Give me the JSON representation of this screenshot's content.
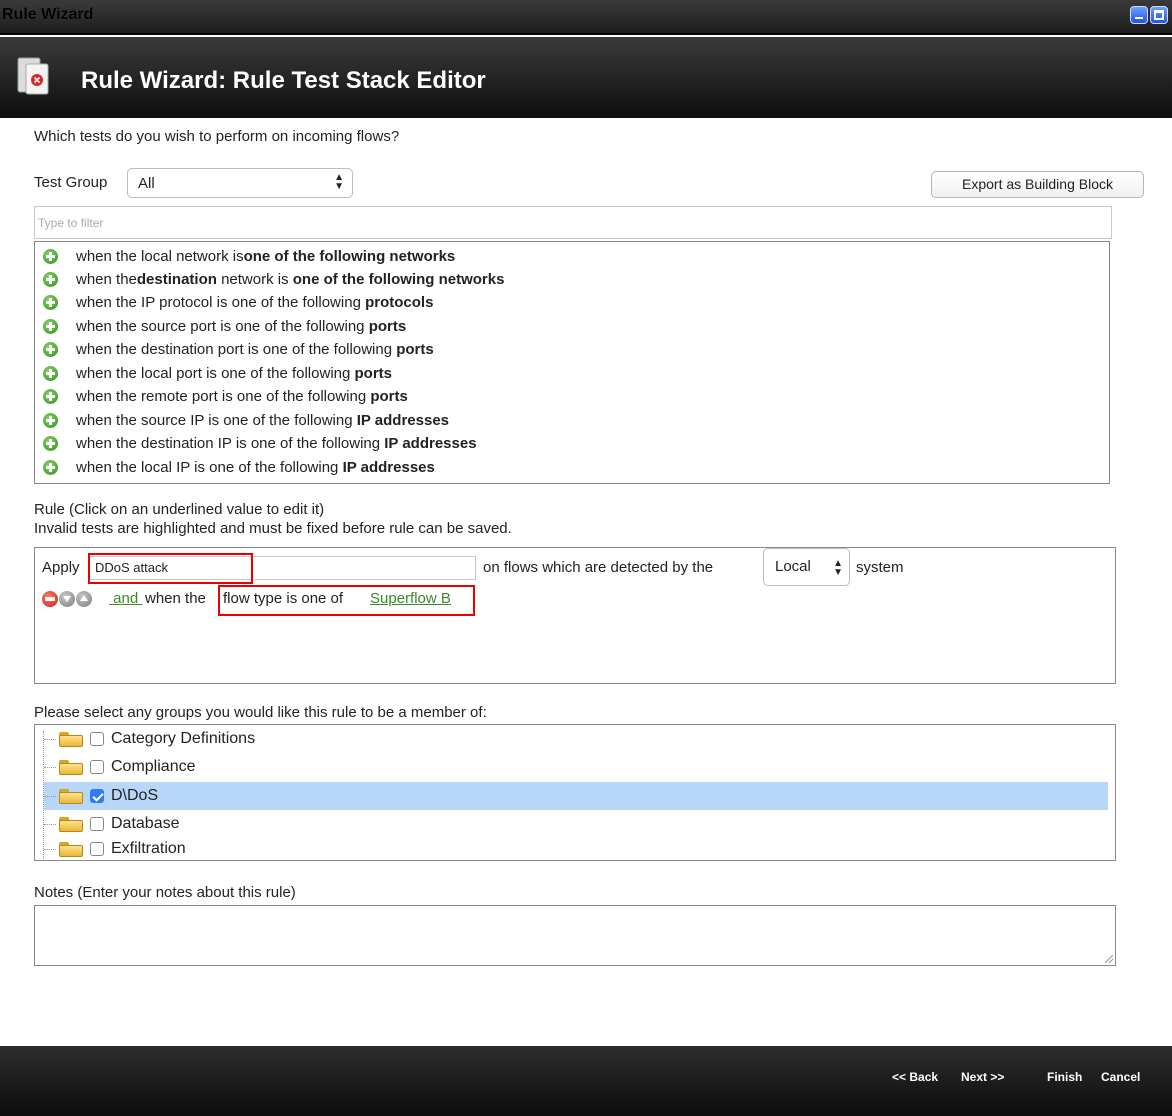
{
  "window": {
    "title": "Rule Wizard"
  },
  "header": {
    "title": "Rule Wizard: Rule Test Stack Editor",
    "icon": "rule-wizard-icon"
  },
  "question": "Which tests do you wish to perform on incoming flows?",
  "test_group": {
    "label": "Test Group",
    "selected": "All"
  },
  "export_button": "Export as Building Block",
  "filter": {
    "placeholder": "Type to filter"
  },
  "tests": [
    {
      "pre": "when the local network is ",
      "b1": "one of the following networks",
      "mid": "",
      "b2": ""
    },
    {
      "pre": "when the ",
      "b1": "destination",
      "mid": " network is ",
      "b2": "one of the following networks"
    },
    {
      "pre": "when the IP protocol is one of the following ",
      "b1": "protocols",
      "mid": "",
      "b2": ""
    },
    {
      "pre": "when the source port is one of the following ",
      "b1": "ports",
      "mid": "",
      "b2": ""
    },
    {
      "pre": "when the destination port is one of the following ",
      "b1": "ports",
      "mid": "",
      "b2": ""
    },
    {
      "pre": "when the local port is one of the following ",
      "b1": "ports",
      "mid": "",
      "b2": ""
    },
    {
      "pre": "when the remote port is one of the following ",
      "b1": "ports",
      "mid": "",
      "b2": ""
    },
    {
      "pre": "when the source IP is one of the following ",
      "b1": "IP addresses",
      "mid": "",
      "b2": ""
    },
    {
      "pre": "when the destination IP is one of the following ",
      "b1": "IP addresses",
      "mid": "",
      "b2": ""
    },
    {
      "pre": "when the local IP is one of the following ",
      "b1": "IP addresses",
      "mid": "",
      "b2": ""
    }
  ],
  "rule_header": {
    "line1": "Rule (Click on an underlined value to edit it)",
    "line2": "Invalid tests are highlighted and must be fixed before rule can be saved."
  },
  "rule": {
    "apply_label": "Apply",
    "name_value": "DDoS attack",
    "on_text": "on flows which are detected by the",
    "system_selected": "Local",
    "system_text": "system",
    "and_link": " and ",
    "when_the": "when the",
    "flow_text": "flow type is one of",
    "flow_value": "Superflow B"
  },
  "groups": {
    "label": "Please select any groups you would like this rule to be a member of:",
    "items": [
      {
        "label": "Category Definitions",
        "checked": false
      },
      {
        "label": "Compliance",
        "checked": false
      },
      {
        "label": "D\\DoS",
        "checked": true
      },
      {
        "label": "Database",
        "checked": false
      },
      {
        "label": "Exfiltration",
        "checked": false
      }
    ]
  },
  "notes": {
    "label": "Notes (Enter your notes about this rule)",
    "value": ""
  },
  "footer": {
    "back": "<< Back",
    "next": "Next >>",
    "finish": "Finish",
    "cancel": "Cancel"
  },
  "colors": {
    "link_green": "#3a8a2a",
    "highlight_red": "#e00000",
    "selection_blue": "#b8d6f8"
  }
}
